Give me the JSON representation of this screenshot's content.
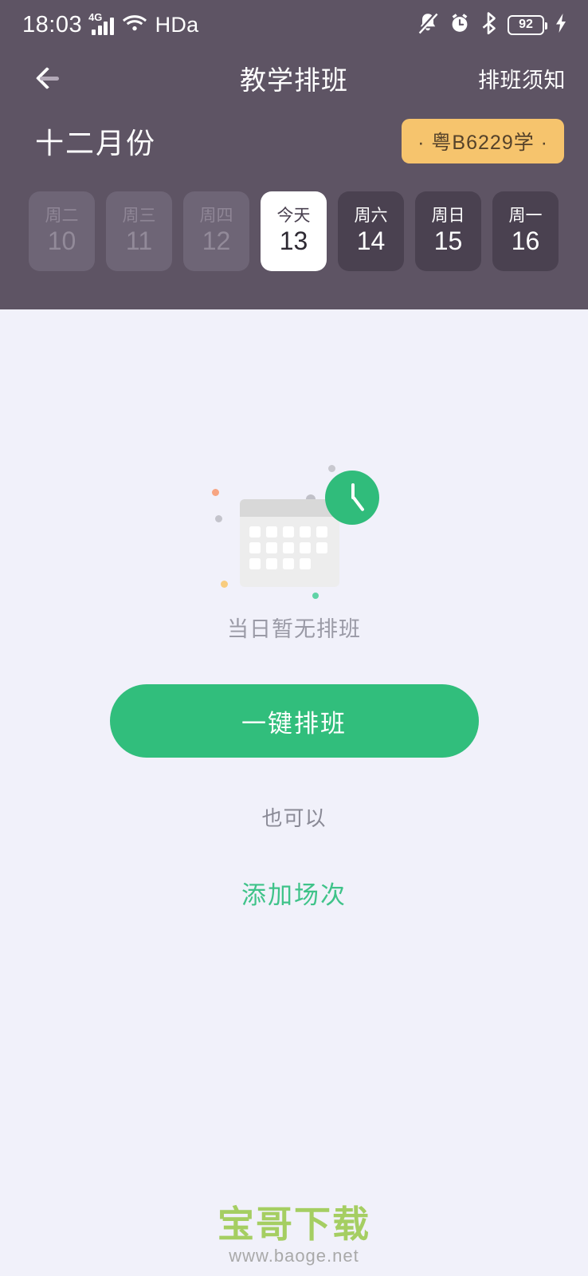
{
  "status_bar": {
    "time": "18:03",
    "network_type": "4G",
    "hd_label": "HDa",
    "battery_percent": "92",
    "icons": {
      "signal": "signal-bars-icon",
      "wifi": "wifi-icon",
      "mute": "bell-muted-icon",
      "alarm": "alarm-clock-icon",
      "bluetooth": "bluetooth-icon",
      "charging": "charging-bolt-icon"
    }
  },
  "navbar": {
    "back_icon": "back-arrow-icon",
    "title": "教学排班",
    "action_label": "排班须知"
  },
  "month_row": {
    "month_label": "十二月份",
    "plate_number": "· 粤B6229学 ·"
  },
  "days": [
    {
      "dow": "周二",
      "num": "10",
      "state": "past"
    },
    {
      "dow": "周三",
      "num": "11",
      "state": "past"
    },
    {
      "dow": "周四",
      "num": "12",
      "state": "past"
    },
    {
      "dow": "今天",
      "num": "13",
      "state": "selected"
    },
    {
      "dow": "周六",
      "num": "14",
      "state": "future"
    },
    {
      "dow": "周日",
      "num": "15",
      "state": "future"
    },
    {
      "dow": "周一",
      "num": "16",
      "state": "future"
    }
  ],
  "empty_state": {
    "illustration": "calendar-clock-illustration",
    "message": "当日暂无排班",
    "cta_label": "一键排班",
    "alt_prefix": "也可以",
    "alt_link_label": "添加场次"
  },
  "watermark": {
    "main": "宝哥下载",
    "sub": "www.baoge.net"
  },
  "colors": {
    "header_bg": "#5E5464",
    "page_bg": "#F1F1FA",
    "accent_green": "#31BE7C",
    "plate_amber": "#F6C46D",
    "chip_future": "#4A4150",
    "chip_past": "#6E6576",
    "watermark_green": "#A5CE62"
  }
}
